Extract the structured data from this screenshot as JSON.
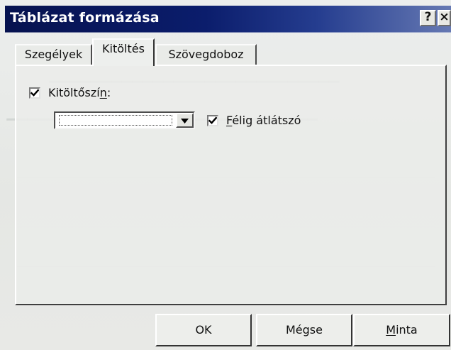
{
  "window": {
    "title": "Táblázat formázása",
    "help_label": "?",
    "close_label": "×"
  },
  "tabs": [
    {
      "label": "Szegélyek",
      "selected": false
    },
    {
      "label": "Kitöltés",
      "selected": true
    },
    {
      "label": "Szövegdoboz",
      "selected": false
    }
  ],
  "fill": {
    "fill_color_label_prefix": "Kitöltőszí",
    "fill_color_label_access": "n",
    "fill_color_label_suffix": ":",
    "fill_color_checked": true,
    "fill_color_value": "",
    "semi_transparent_label_access": "F",
    "semi_transparent_label_rest": "élig átlátszó",
    "semi_transparent_checked": true
  },
  "buttons": {
    "ok": "OK",
    "cancel": "Mégse",
    "preview_access": "M",
    "preview_rest": "inta"
  },
  "colors": {
    "title_dark": "#06124f",
    "dialog_gray": "#e7e9e6"
  },
  "icons": {
    "check": "check-icon",
    "dropdown": "chevron-down-icon",
    "close": "close-icon",
    "help": "help-icon"
  }
}
